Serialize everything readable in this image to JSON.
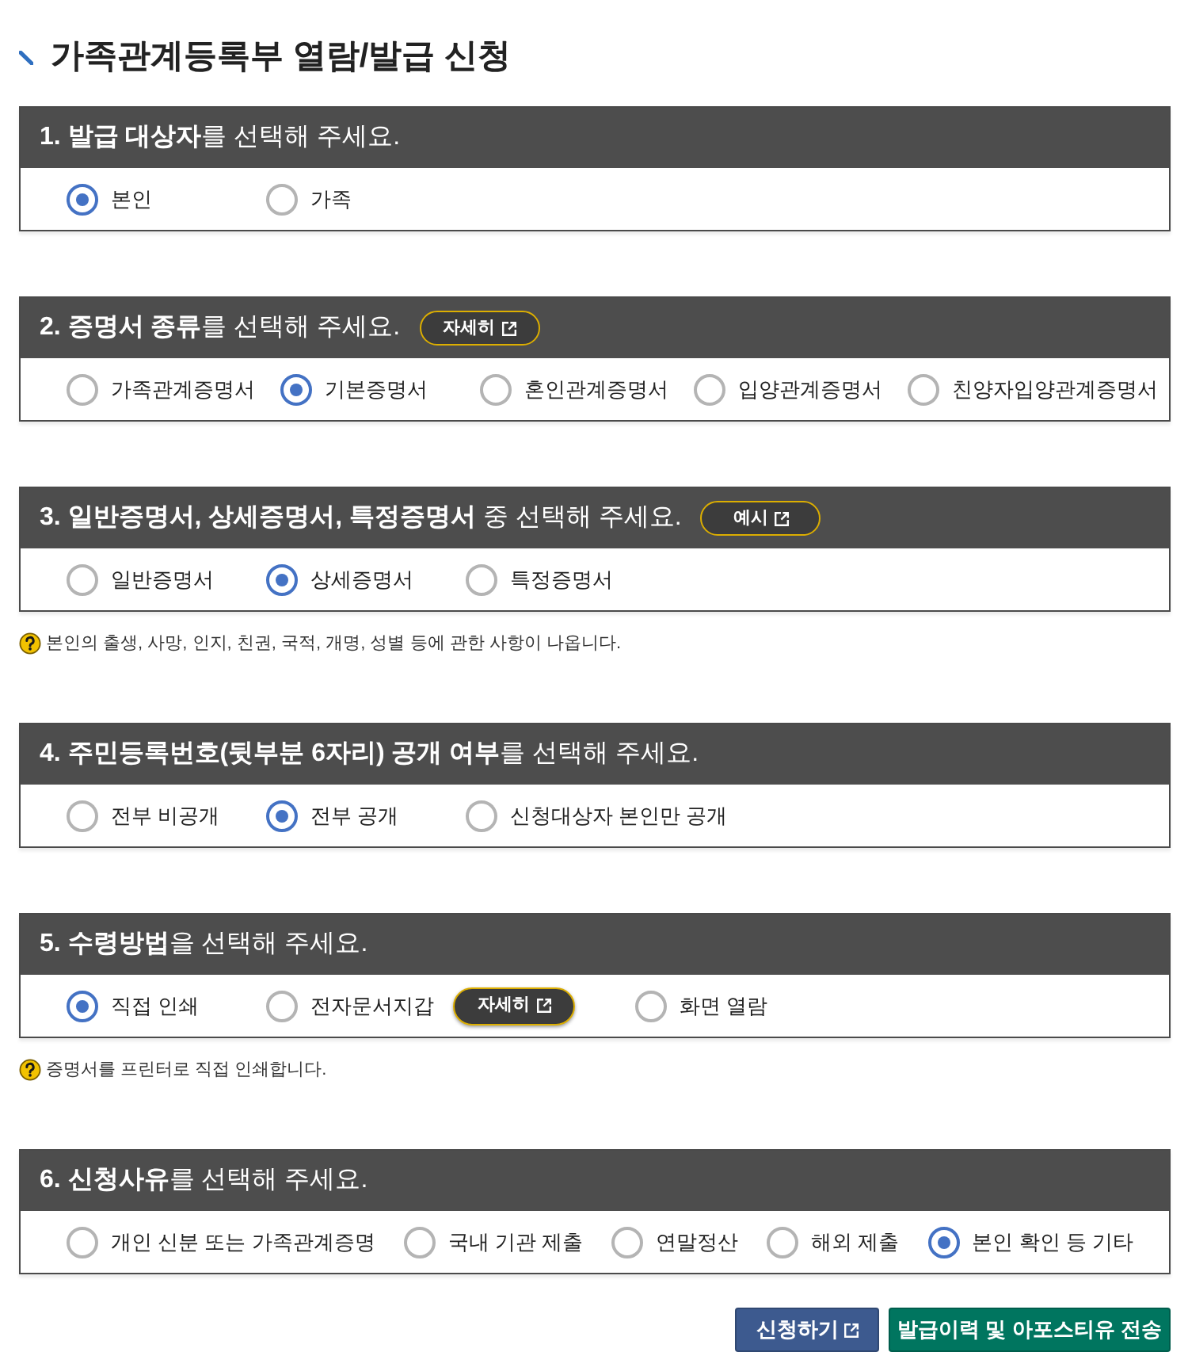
{
  "page": {
    "title": "가족관계등록부 열람/발급 신청"
  },
  "sections": [
    {
      "heading": "**1. 발급 대상자**를 선택해 주세요.",
      "options": [
        {
          "label": "본인",
          "selected": true
        },
        {
          "label": "가족",
          "selected": false
        }
      ]
    },
    {
      "heading": "**2. 증명서 종류**를 선택해 주세요.",
      "heading_button": {
        "label": "자세히"
      },
      "options": [
        {
          "label": "가족관계증명서",
          "selected": false
        },
        {
          "label": "기본증명서",
          "selected": true
        },
        {
          "label": "혼인관계증명서",
          "selected": false
        },
        {
          "label": "입양관계증명서",
          "selected": false
        },
        {
          "label": "친양자입양관계증명서",
          "selected": false
        }
      ]
    },
    {
      "heading": "**3. 일반증명서, 상세증명서, 특정증명서** 중 선택해 주세요.",
      "heading_button": {
        "label": "예시"
      },
      "options": [
        {
          "label": "일반증명서",
          "selected": false
        },
        {
          "label": "상세증명서",
          "selected": true
        },
        {
          "label": "특정증명서",
          "selected": false
        }
      ],
      "note": "본인의 출생, 사망, 인지, 친권, 국적, 개명, 성별 등에 관한 사항이 나옵니다."
    },
    {
      "heading": "**4. 주민등록번호(뒷부분 6자리) 공개 여부**를 선택해 주세요.",
      "options": [
        {
          "label": "전부 비공개",
          "selected": false
        },
        {
          "label": "전부 공개",
          "selected": true
        },
        {
          "label": "신청대상자 본인만 공개",
          "selected": false
        }
      ]
    },
    {
      "heading": "**5. 수령방법**을 선택해 주세요.",
      "options": [
        {
          "label": "직접 인쇄",
          "selected": true
        },
        {
          "label": "전자문서지갑",
          "selected": false,
          "detail_button": {
            "label": "자세히"
          }
        },
        {
          "label": "화면 열람",
          "selected": false
        }
      ],
      "note": "증명서를 프린터로 직접 인쇄합니다."
    },
    {
      "heading": "**6. 신청사유**를 선택해 주세요.",
      "options": [
        {
          "label": "개인 신분 또는 가족관계증명",
          "selected": false
        },
        {
          "label": "국내 기관 제출",
          "selected": false
        },
        {
          "label": "연말정산",
          "selected": false
        },
        {
          "label": "해외 제출",
          "selected": false
        },
        {
          "label": "본인 확인 등 기타",
          "selected": true
        }
      ]
    }
  ],
  "buttons": [
    {
      "label": "신청하기",
      "kind": "popup"
    },
    {
      "label": "발급이력 및 아포스티유 전송",
      "kind": "action"
    }
  ]
}
